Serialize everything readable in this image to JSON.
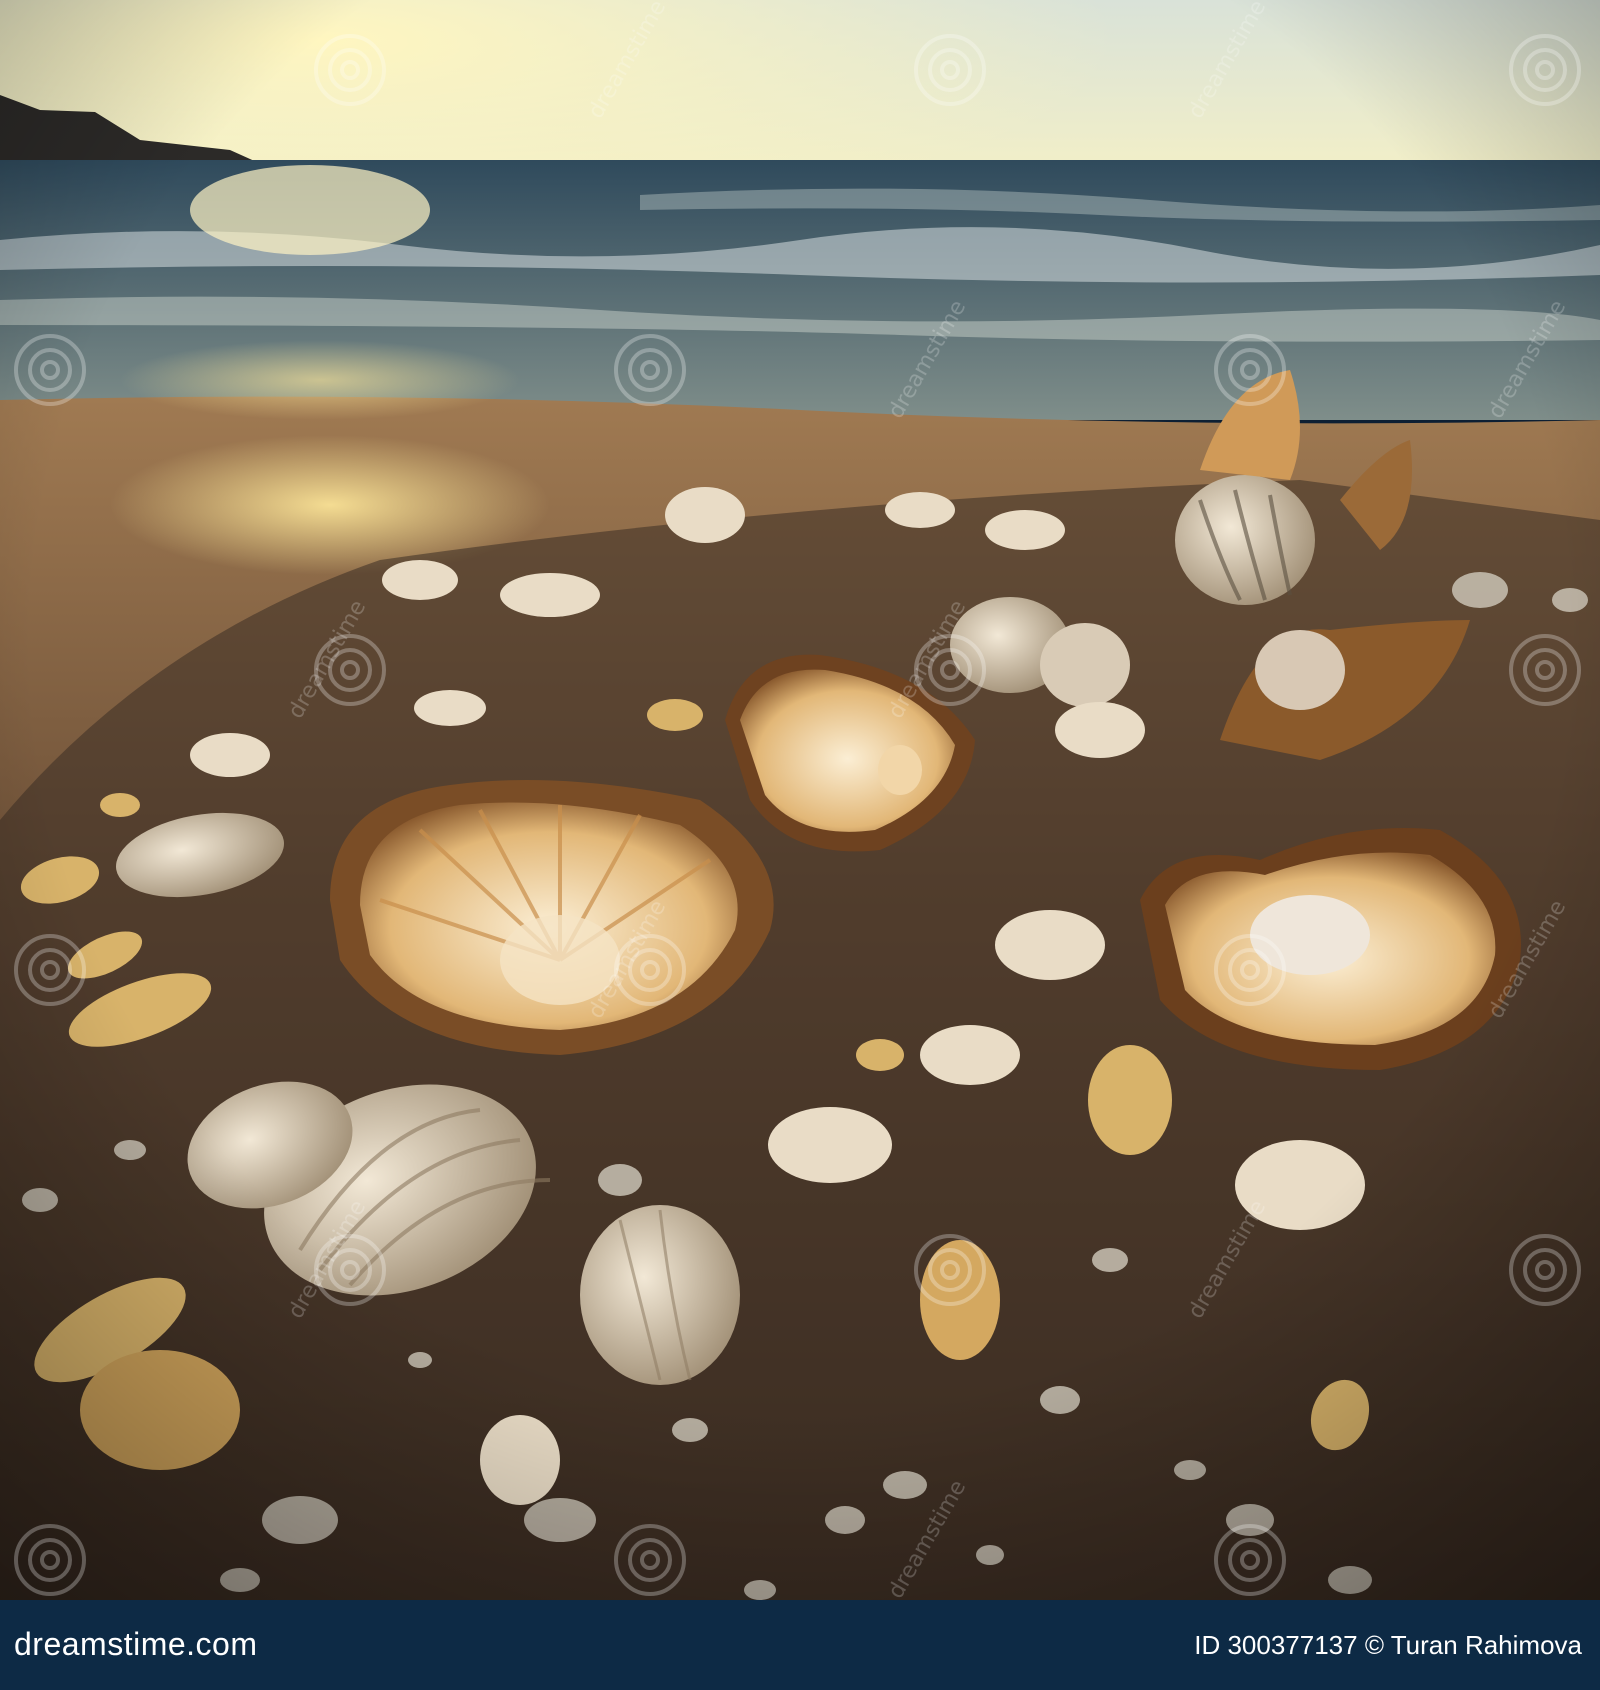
{
  "footer": {
    "site": "dreamstime.com",
    "id_label": "ID",
    "id_value": "300377137",
    "copyright": "©",
    "author": "Turan Rahimova"
  },
  "watermark": {
    "text": "dreamstime"
  },
  "colors": {
    "footer_bg": "#0d2a45",
    "sand": "#7a5a3c",
    "sea": "#304c5e",
    "sky": "#e9ecd0"
  }
}
